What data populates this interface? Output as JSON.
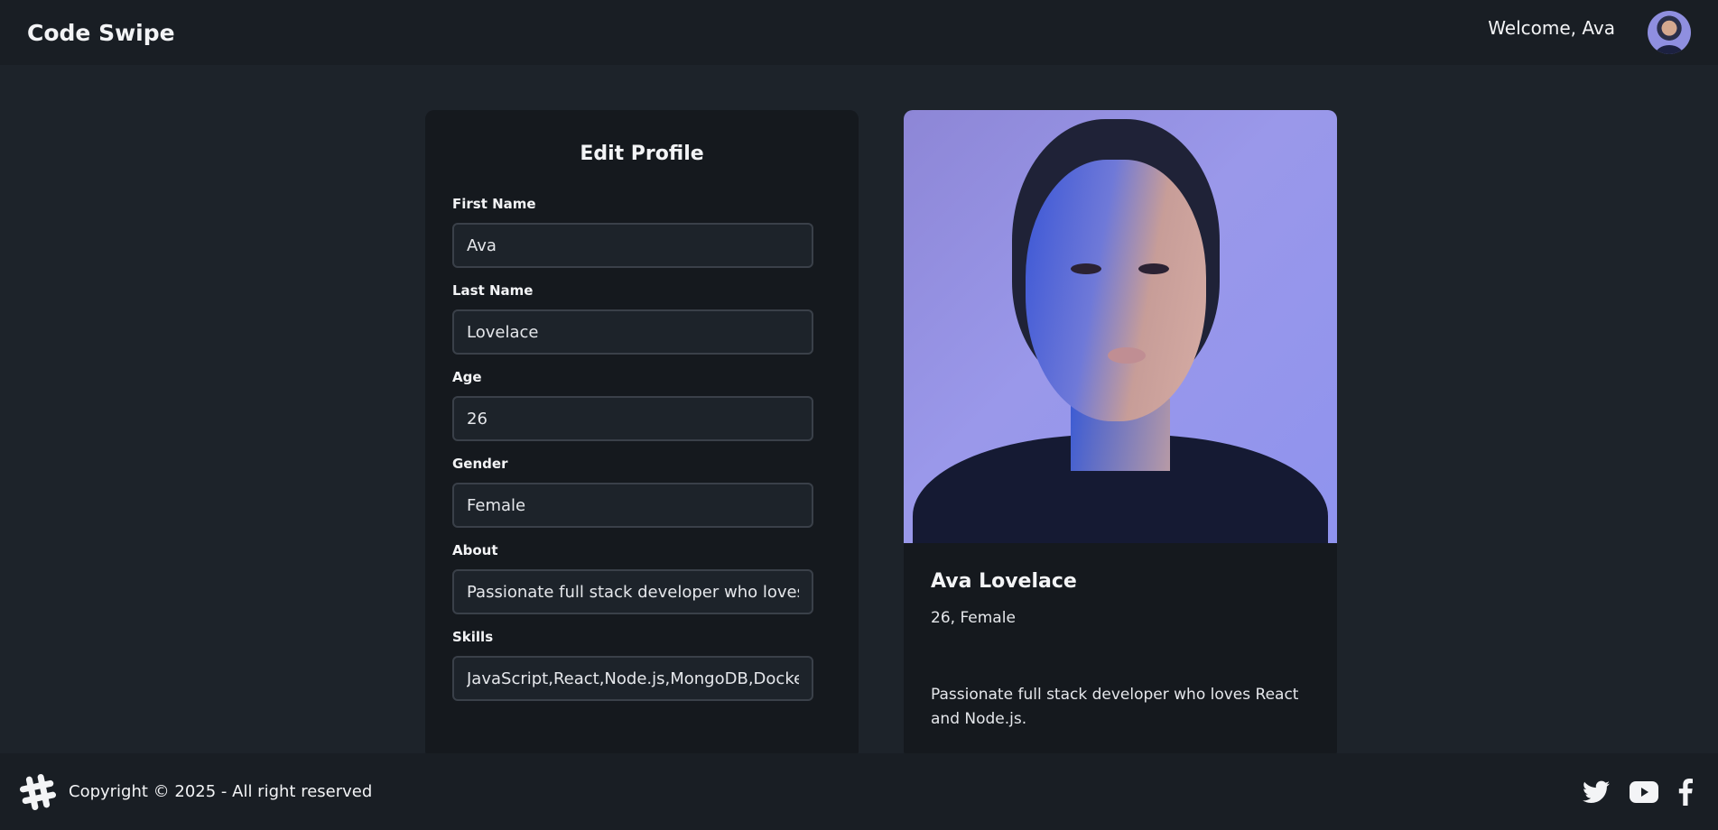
{
  "navbar": {
    "brand": "Code Swipe",
    "welcome": "Welcome, Ava"
  },
  "form": {
    "title": "Edit Profile",
    "fields": [
      {
        "label": "First Name",
        "value": "Ava"
      },
      {
        "label": "Last Name",
        "value": "Lovelace"
      },
      {
        "label": "Age",
        "value": "26"
      },
      {
        "label": "Gender",
        "value": "Female"
      },
      {
        "label": "About",
        "value": "Passionate full stack developer who loves React and Node.js."
      },
      {
        "label": "Skills",
        "value": "JavaScript,React,Node.js,MongoDB,Docker"
      }
    ]
  },
  "profile": {
    "name": "Ava Lovelace",
    "meta": "26, Female",
    "about": "Passionate full stack developer who loves React and Node.js."
  },
  "footer": {
    "copyright": "Copyright © 2025 - All right reserved"
  },
  "icons": {
    "logo": "hashtag-icon",
    "social": [
      "twitter-icon",
      "youtube-icon",
      "facebook-icon"
    ]
  }
}
